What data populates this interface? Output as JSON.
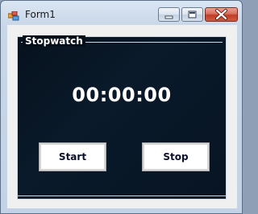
{
  "window": {
    "title": "Form1",
    "app_icon": "winforms-app-icon",
    "controls": {
      "minimize": "minimize-icon",
      "maximize": "maximize-icon",
      "close": "close-icon"
    }
  },
  "stopwatch": {
    "group_label": "Stopwatch",
    "time_display": "00:00:00",
    "start_label": "Start",
    "stop_label": "Stop"
  },
  "colors": {
    "panel_background": "#071423",
    "text": "#ffffff",
    "close_button": "#c94a33"
  }
}
